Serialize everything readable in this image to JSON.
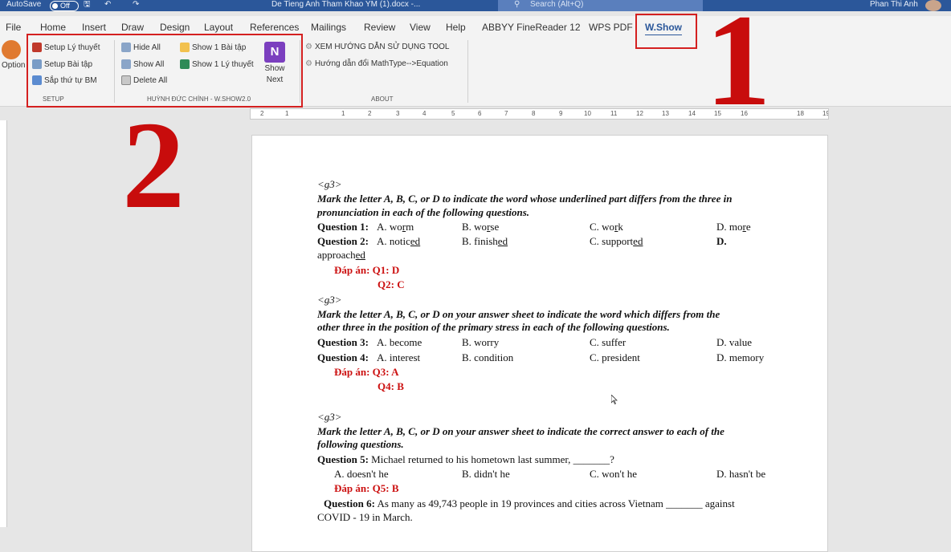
{
  "titlebar": {
    "autosave_label": "AutoSave",
    "autosave_state": "Off",
    "doc_title": "De Tieng Anh Tham Khao YM (1).docx  -...",
    "search_placeholder": "Search (Alt+Q)",
    "user_name": "Phan Thi Anh"
  },
  "menu": {
    "tabs": [
      "File",
      "Home",
      "Insert",
      "Draw",
      "Design",
      "Layout",
      "References",
      "Mailings",
      "Review",
      "View",
      "Help",
      "ABBYY FineReader 12",
      "WPS PDF",
      "W.Show"
    ]
  },
  "ribbon": {
    "options_label": "Option",
    "setup": {
      "items": [
        "Setup Lý thuyết",
        "Setup Bài tập",
        "Sắp thứ tự BM"
      ],
      "group_label": "SETUP"
    },
    "huynh": {
      "col1": [
        "Hide All",
        "Show All",
        "Delete All"
      ],
      "col2": [
        "Show 1 Bài tập",
        "Show 1 Lý thuyết"
      ],
      "show_next": "Show Next",
      "show_next_l1": "Show",
      "show_next_l2": "Next",
      "group_label": "HUỲNH ĐỨC CHÍNH - W.SHOW2.0"
    },
    "about": {
      "items": [
        "XEM HƯỚNG DẪN SỬ DỤNG TOOL",
        "Hướng dẫn đổi MathType-->Equation"
      ],
      "group_label": "ABOUT"
    }
  },
  "annotations": {
    "n1": "1",
    "n2": "2"
  },
  "ruler_ticks": [
    "2",
    "1",
    "1",
    "2",
    "3",
    "4",
    "5",
    "6",
    "7",
    "8",
    "9",
    "10",
    "11",
    "12",
    "13",
    "14",
    "15",
    "16",
    "18",
    "19"
  ],
  "document": {
    "g3": "<g3>",
    "s1_instr1": "Mark the letter A, B, C, or D to indicate the word whose underlined part differs from the three in",
    "s1_instr2": "pronunciation in each of the following questions.",
    "q1": {
      "label": "Question 1:",
      "a": "A. wo",
      "a_u": "r",
      "a_rest": "m",
      "b": "B. wo",
      "b_u": "r",
      "b_rest": "se",
      "c": "C. wo",
      "c_u": "r",
      "c_rest": "k",
      "d": "D. mo",
      "d_u": "r",
      "d_rest": "e"
    },
    "q2": {
      "label": "Question 2:",
      "a": "A. notic",
      "a_u": "ed",
      "b": "B. finish",
      "b_u": "ed",
      "c": "C. support",
      "c_u": "ed",
      "d": "D.",
      "d_cont": "approach",
      "d_cont_u": "ed"
    },
    "ans1_label": "Đáp án: Q1: D",
    "ans1_q2": "Q2: C",
    "s2_instr1": "Mark the letter A, B, C, or D on your answer sheet to indicate the word which differs from the",
    "s2_instr2": "other three in the position of the primary stress in each of the following questions.",
    "q3": {
      "label": "Question 3:",
      "a": "A. become",
      "b": "B. worry",
      "c": "C. suffer",
      "d": "D. value"
    },
    "q4": {
      "label": "Question 4:",
      "a": "A. interest",
      "b": "B. condition",
      "c": "C. president",
      "d": "D. memory"
    },
    "ans2_label": "Đáp án: Q3: A",
    "ans2_q4": "Q4: B",
    "s3_instr1": "Mark the letter A, B, C, or D on your answer sheet to indicate the correct answer to each of the",
    "s3_instr2": "following questions.",
    "q5": {
      "label": "Question 5:",
      "text": "Michael returned to his hometown last summer, _______?",
      "a": "A. doesn't he",
      "b": "B. didn't he",
      "c": "C. won't he",
      "d": "D. hasn't be"
    },
    "ans3_label": "Đáp án: Q5: B",
    "q6": {
      "label": "Question 6:",
      "text": "As many as 49,743 people in 19 provinces and cities across Vietnam _______ against",
      "text2": "COVID - 19 in March."
    }
  }
}
